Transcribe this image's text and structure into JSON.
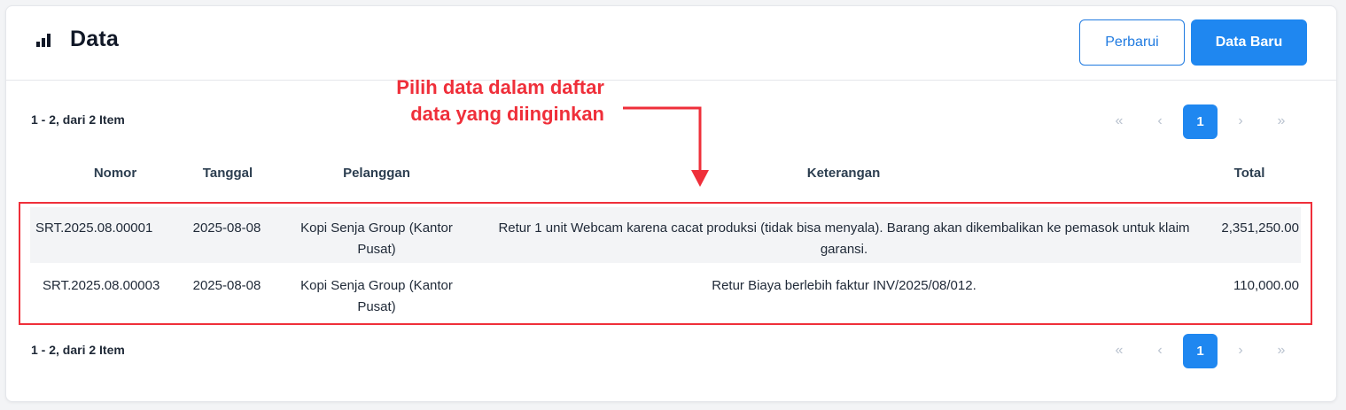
{
  "header": {
    "title": "Data",
    "refresh_label": "Perbarui",
    "new_label": "Data Baru"
  },
  "pagination": {
    "summary": "1 - 2, dari 2 Item",
    "first": "«",
    "prev": "‹",
    "current": "1",
    "next": "›",
    "last": "»"
  },
  "table": {
    "columns": [
      "Nomor",
      "Tanggal",
      "Pelanggan",
      "Keterangan",
      "Total"
    ],
    "rows": [
      {
        "nomor": "SRT.2025.08.00001",
        "tanggal": "2025-08-08",
        "pelanggan": "Kopi Senja Group (Kantor Pusat)",
        "keterangan": "Retur 1 unit Webcam karena cacat produksi (tidak bisa menyala). Barang akan dikembalikan ke pemasok untuk klaim garansi.",
        "total": "2,351,250.00"
      },
      {
        "nomor": "SRT.2025.08.00003",
        "tanggal": "2025-08-08",
        "pelanggan": "Kopi Senja Group (Kantor Pusat)",
        "keterangan": "Retur Biaya berlebih faktur INV/2025/08/012.",
        "total": "110,000.00"
      }
    ]
  },
  "annotation": {
    "text": "Pilih data dalam daftar data yang diinginkan",
    "color": "#ef2f3a"
  },
  "colors": {
    "accent": "#1f87f0",
    "highlight": "#ef2f3a"
  }
}
